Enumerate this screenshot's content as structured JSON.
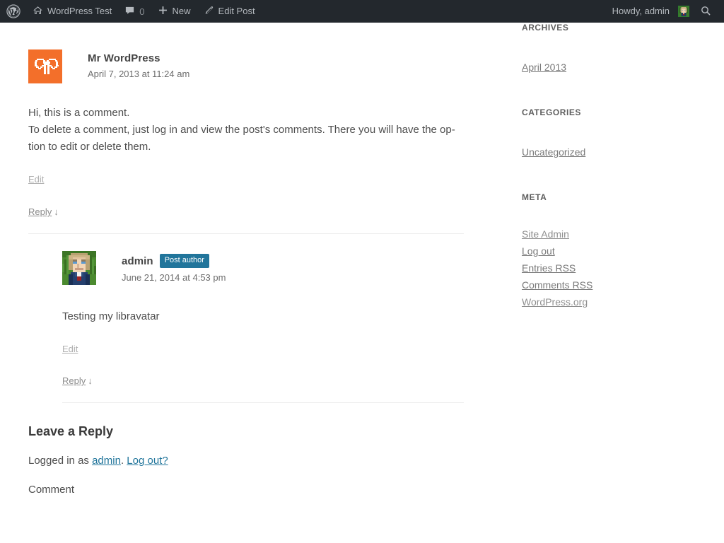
{
  "adminbar": {
    "logo_icon": "wordpress-logo-icon",
    "site_title": "WordPress Test",
    "site_icon": "home-icon",
    "comments_icon": "comment-bubble-icon",
    "comments_count": "0",
    "new_icon": "plus-icon",
    "new_label": "New",
    "edit_icon": "pencil-icon",
    "edit_label": "Edit Post",
    "howdy": "Howdy, admin",
    "search_icon": "search-icon",
    "avatar_alt": "admin-avatar"
  },
  "comments": [
    {
      "id": "comment-1",
      "author": "Mr WordPress",
      "date": "April 7, 2013 at 11:24 am",
      "avatar_type": "identicon-butterfly",
      "avatar_bg": "#f36f2a",
      "is_post_author": false,
      "badge": "",
      "body_lines": [
        "Hi, this is a comment.",
        "To delete a comment, just log in and view the post's comments. There you will have the op-tion to edit or delete them."
      ],
      "edit_label": "Edit",
      "reply_label": "Reply",
      "reply_arrow": "↓"
    },
    {
      "id": "comment-2",
      "author": "admin",
      "date": "June 21, 2014 at 4:53 pm",
      "avatar_type": "pixel-portrait-libravatar",
      "avatar_bg": "#3f7a2b",
      "is_post_author": true,
      "badge": "Post author",
      "body_lines": [
        "Testing my libravatar"
      ],
      "edit_label": "Edit",
      "reply_label": "Reply",
      "reply_arrow": "↓"
    }
  ],
  "respond": {
    "title": "Leave a Reply",
    "logged_in_prefix": "Logged in as ",
    "logged_in_user": "admin",
    "logged_in_separator": ". ",
    "logout_label": "Log out?",
    "comment_label": "Comment"
  },
  "sidebar": {
    "widgets": [
      {
        "title": "ARCHIVES",
        "items": [
          {
            "label": "April 2013"
          }
        ]
      },
      {
        "title": "CATEGORIES",
        "items": [
          {
            "label": "Uncategorized"
          }
        ]
      },
      {
        "title": "META",
        "items": [
          {
            "label": "Site Admin"
          },
          {
            "label": "Log out"
          },
          {
            "label": "Entries RSS"
          },
          {
            "label": "Comments RSS"
          },
          {
            "label": "WordPress.org"
          }
        ]
      }
    ]
  },
  "colors": {
    "adminbar_bg": "#23282d",
    "adminbar_text": "#b4b9be",
    "badge_bg": "#21759b",
    "link_blue": "#21759b",
    "identicon_orange": "#f36f2a",
    "divider": "#ededed"
  }
}
